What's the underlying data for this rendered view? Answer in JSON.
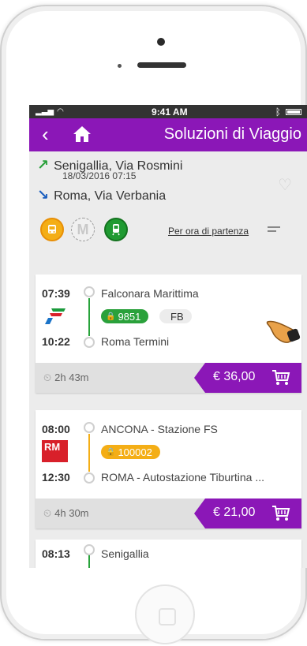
{
  "statusbar": {
    "time": "9:41 AM"
  },
  "appbar": {
    "title": "Soluzioni di Viaggio",
    "back_icon": "chevron-left-icon",
    "home_icon": "home-icon"
  },
  "route": {
    "from": "Senigallia, Via Rosmini",
    "datetime": "18/03/2016 07:15",
    "to": "Roma, Via Verbania"
  },
  "filters": {
    "sort_label": "Per ora di partenza",
    "metro_letter": "M"
  },
  "solutions": [
    {
      "dep_time": "07:39",
      "dep_stop": "Falconara Marittima",
      "arr_time": "10:22",
      "arr_stop": "Roma Termini",
      "code": "9851",
      "type": "FB",
      "duration": "2h 43m",
      "price": "€ 36,00",
      "operator_icon": "trenitalia-logo-icon",
      "line_color": "#2aa13b"
    },
    {
      "dep_time": "08:00",
      "dep_stop": "ANCONA - Stazione FS",
      "arr_time": "12:30",
      "arr_stop": "ROMA - Autostazione Tiburtina ...",
      "code": "100002",
      "duration": "4h 30m",
      "price": "€ 21,00",
      "operator_label": "RM",
      "line_color": "#f4ae16"
    },
    {
      "dep_time": "08:13",
      "dep_stop": "Senigallia"
    }
  ],
  "colors": {
    "accent": "#8b17b7",
    "train": "#2aa13b",
    "bus": "#f4ae16"
  }
}
